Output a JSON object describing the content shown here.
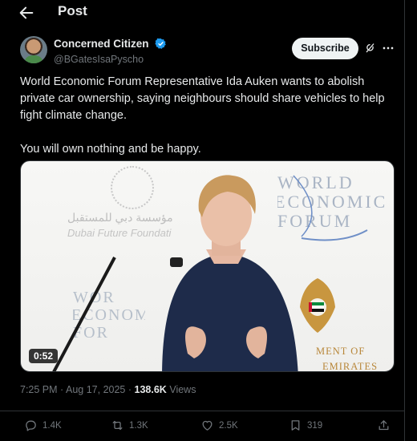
{
  "header": {
    "title": "Post",
    "back_icon": "arrow-left-icon"
  },
  "author": {
    "display_name": "Concerned Citizen",
    "handle": "@BGatesIsaPyscho",
    "verified": true,
    "verified_color": "#1d9bf0"
  },
  "actions_top": {
    "subscribe_label": "Subscribe",
    "grok_icon": "grok-icon",
    "more_icon": "more-horizontal-icon"
  },
  "tweet": {
    "paragraphs": [
      "World Economic Forum Representative Ida Auken wants to abolish private car ownership, saying neighbours should share vehicles to help fight climate change.",
      "You will own nothing and be happy."
    ]
  },
  "media": {
    "duration": "0:52",
    "wef_logo_lines": [
      "W",
      "ORLD",
      "EC",
      "ONOMIC",
      "F",
      "ORUM"
    ],
    "wef_logo": "WORLD ECONOMIC FORUM",
    "wef_logo_lower": "WOR ECONOM FOR",
    "dfc_arabic": "مؤسسة دبي للمستقبل",
    "dfc_english": "Dubai Future Foundati",
    "uae_text_line1": "MENT OF",
    "uae_text_line2": "EMIRATES"
  },
  "meta": {
    "time": "7:25 PM",
    "separator": "·",
    "date": "Aug 17, 2025",
    "views_count": "138.6K",
    "views_label": "Views"
  },
  "stats": {
    "replies": "1.4K",
    "reposts": "1.3K",
    "likes": "2.5K",
    "bookmarks": "319"
  }
}
